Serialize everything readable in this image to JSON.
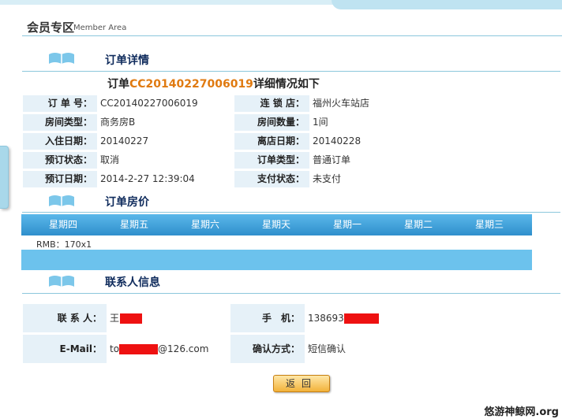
{
  "member": {
    "title": "会员专区",
    "subtitle": "Member Area"
  },
  "sections": {
    "order": "订单详情",
    "price": "订单房价",
    "contact": "联系人信息"
  },
  "summary": {
    "prefix": "订单",
    "order_no": "CC20140227006019",
    "suffix": "详细情况如下"
  },
  "details": [
    {
      "l1": "订 单 号：",
      "v1": "CC20140227006019",
      "l2": "连 锁 店：",
      "v2": "福州火车站店"
    },
    {
      "l1": "房间类型：",
      "v1": "商务房B",
      "l2": "房间数量：",
      "v2": "1间"
    },
    {
      "l1": "入住日期：",
      "v1": "20140227",
      "l2": "离店日期：",
      "v2": "20140228"
    },
    {
      "l1": "预订状态：",
      "v1": "取消",
      "l2": "订单类型：",
      "v2": "普通订单"
    },
    {
      "l1": "预订日期：",
      "v1": "2014-2-27 12:39:04",
      "l2": "支付状态：",
      "v2": "未支付"
    }
  ],
  "price": {
    "days": [
      "星期四",
      "星期五",
      "星期六",
      "星期天",
      "星期一",
      "星期二",
      "星期三"
    ],
    "rmb": "RMB：170x1"
  },
  "contact": {
    "name_label": "联 系 人：",
    "name_value": "王",
    "phone_label": "手　机：",
    "phone_value": "138693",
    "email_label": "E-Mail：",
    "email_prefix": "to",
    "email_suffix": "@126.com",
    "confirm_label": "确认方式：",
    "confirm_value": "短信确认"
  },
  "buttons": {
    "back": "返回"
  },
  "watermark": "悠游神鲸网.org",
  "colors": {
    "accent": "#3e9fd8",
    "highlight": "#e07a10",
    "redact": "#ee1111"
  }
}
